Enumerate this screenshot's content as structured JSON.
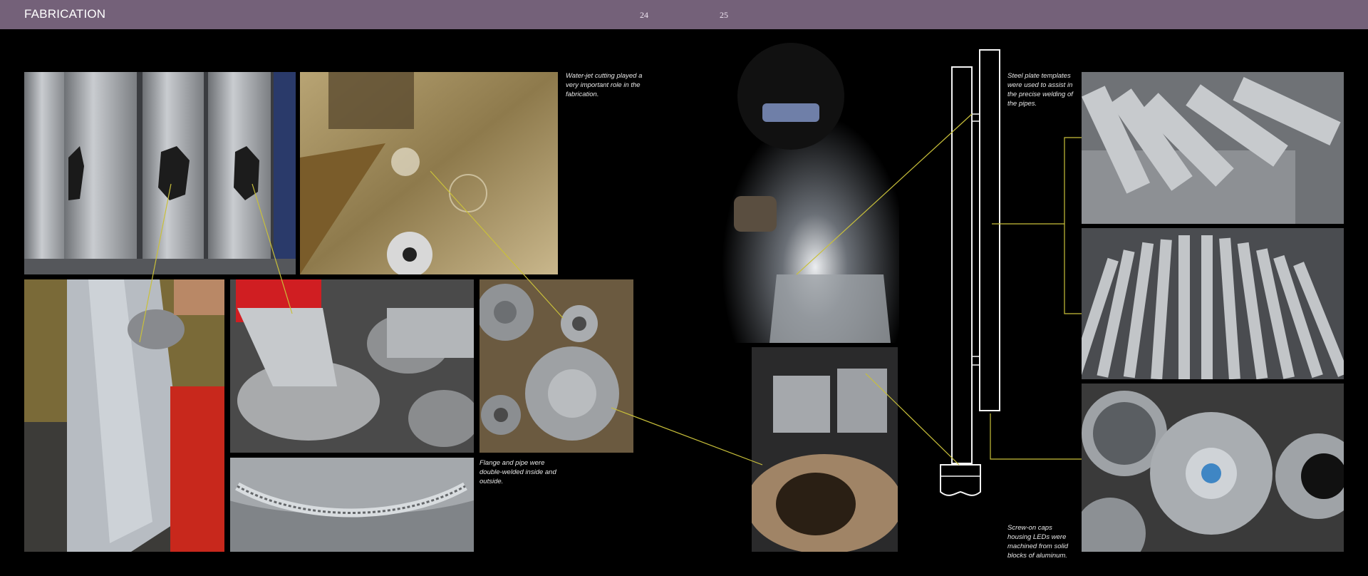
{
  "header": {
    "section_title": "FABRICATION",
    "page_left": "24",
    "page_right": "25",
    "bg_color": "#746179"
  },
  "captions": {
    "waterjet": "Water-jet cutting played a very important role in the fabrication.",
    "flange": "Flange and pipe were double-welded inside and outside.",
    "templates": "Steel plate templates were used to assist in the precise welding of the pipes.",
    "caps": "Screw-on caps housing LEDs were machined from solid blocks of aluminum."
  },
  "callout_color": "#c9c03a"
}
